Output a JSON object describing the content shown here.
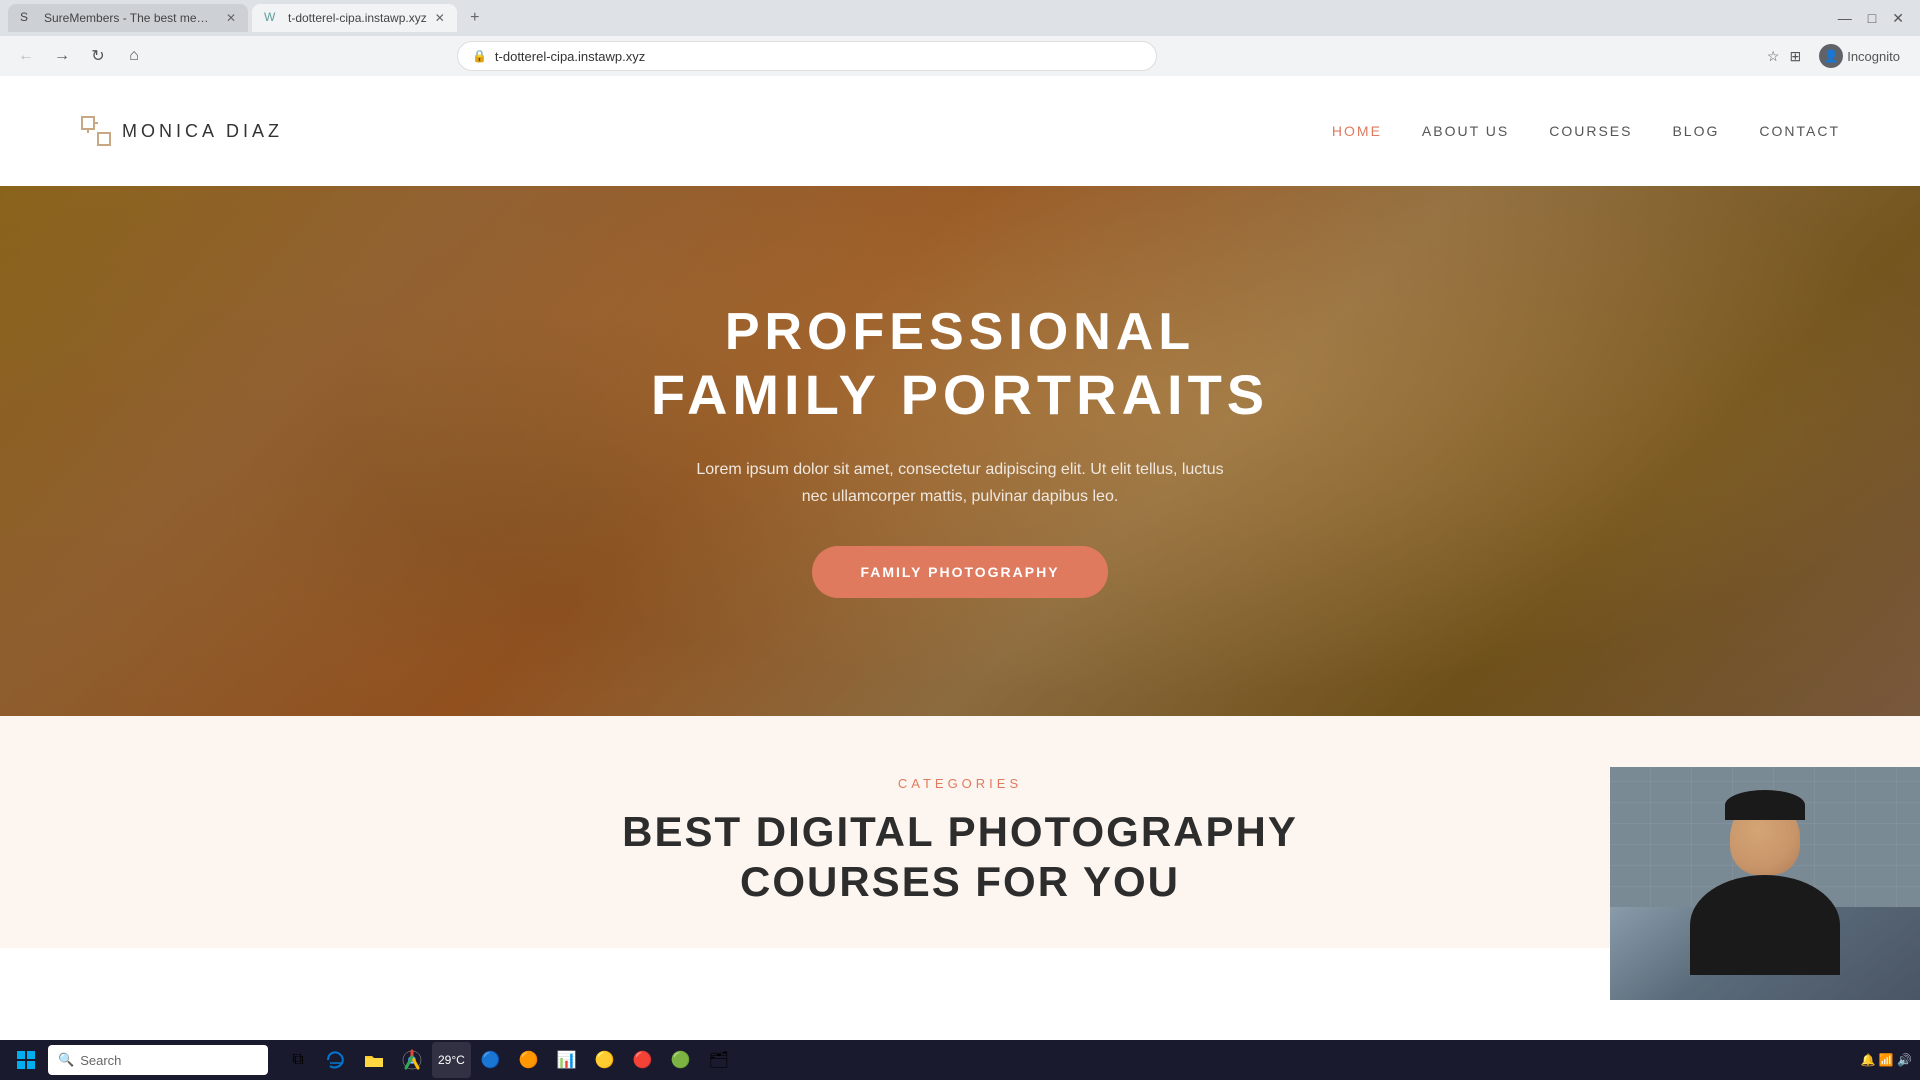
{
  "browser": {
    "tabs": [
      {
        "id": "tab1",
        "title": "SureMembers - The best memb...",
        "favicon": "S",
        "active": false
      },
      {
        "id": "tab2",
        "title": "t-dotterel-cipa.instawp.xyz",
        "favicon": "W",
        "active": true
      }
    ],
    "new_tab_label": "+",
    "controls": {
      "minimize": "—",
      "maximize": "□",
      "close": "✕"
    },
    "nav": {
      "back": "←",
      "forward": "→",
      "refresh": "↻",
      "home": "⌂"
    },
    "url": "t-dotterel-cipa.instawp.xyz",
    "bookmark_icon": "☆",
    "extensions_icon": "⊞",
    "profile_label": "Incognito"
  },
  "website": {
    "header": {
      "logo_name": "MONICA  DIAZ",
      "nav": {
        "home": "HOME",
        "about": "ABOUT US",
        "courses": "COURSES",
        "blog": "BLOG",
        "contact": "CONTACT"
      }
    },
    "hero": {
      "title_line1": "PROFESSIONAL",
      "title_line2": "FAMILY PORTRAITS",
      "subtitle": "Lorem ipsum dolor sit amet, consectetur adipiscing elit. Ut elit tellus, luctus\nnec ullamcorper mattis, pulvinar dapibus leo.",
      "cta_button": "FAMILY PHOTOGRAPHY"
    },
    "categories": {
      "label": "CATEGORIES",
      "title_line1": "BEST DIGITAL PHOTOGRAPHY",
      "title_line2": "COURSES FOR YOU"
    }
  },
  "taskbar": {
    "start_icon": "⊞",
    "search_placeholder": "Search",
    "apps": [
      {
        "name": "task-view",
        "icon": "⧉"
      },
      {
        "name": "edge-browser",
        "icon": "🌐"
      },
      {
        "name": "file-explorer",
        "icon": "📁"
      },
      {
        "name": "chrome-browser",
        "icon": "●"
      },
      {
        "name": "app-unknown1",
        "icon": "🔵"
      },
      {
        "name": "app-unknown2",
        "icon": "🟠"
      },
      {
        "name": "app-unknown3",
        "icon": "🟡"
      },
      {
        "name": "app-unknown4",
        "icon": "🔴"
      },
      {
        "name": "app-unknown5",
        "icon": "🟤"
      },
      {
        "name": "app-unknown6",
        "icon": "🟢"
      },
      {
        "name": "app-unknown7",
        "icon": "🔷"
      }
    ],
    "time": "29°C",
    "system_icons": "🔔 📶 🔊"
  }
}
